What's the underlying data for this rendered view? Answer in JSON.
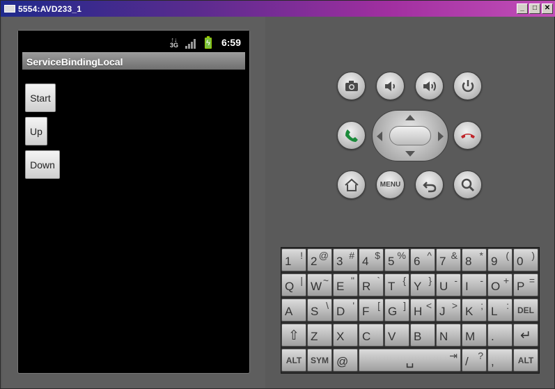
{
  "window": {
    "title": "5554:AVD233_1",
    "minimize": "_",
    "maximize": "□",
    "close": "✕"
  },
  "status_bar": {
    "time": "6:59",
    "network": "3G"
  },
  "app": {
    "title": "ServiceBindingLocal",
    "buttons": [
      "Start",
      "Up",
      "Down"
    ]
  },
  "controls": {
    "camera": "camera-icon",
    "volume_down": "volume-down-icon",
    "volume_up": "volume-up-icon",
    "power": "power-icon",
    "call": "call-icon",
    "end_call": "end-call-icon",
    "home": "home-icon",
    "menu": "MENU",
    "back": "back-icon",
    "search": "search-icon"
  },
  "keyboard": {
    "rows": [
      [
        [
          "1",
          "!"
        ],
        [
          "2",
          "@"
        ],
        [
          "3",
          "#"
        ],
        [
          "4",
          "$"
        ],
        [
          "5",
          "%"
        ],
        [
          "6",
          "^"
        ],
        [
          "7",
          "&"
        ],
        [
          "8",
          "*"
        ],
        [
          "9",
          "("
        ],
        [
          "0",
          ")"
        ]
      ],
      [
        [
          "Q",
          "|"
        ],
        [
          "W",
          "~"
        ],
        [
          "E",
          "\""
        ],
        [
          "R",
          "`"
        ],
        [
          "T",
          "{"
        ],
        [
          "Y",
          "}"
        ],
        [
          "U",
          "-"
        ],
        [
          "I",
          "-"
        ],
        [
          "O",
          "+"
        ],
        [
          "P",
          "="
        ]
      ],
      [
        [
          "A",
          ""
        ],
        [
          "S",
          "\\"
        ],
        [
          "D",
          "'"
        ],
        [
          "F",
          "["
        ],
        [
          "G",
          "]"
        ],
        [
          "H",
          "<"
        ],
        [
          "J",
          ">"
        ],
        [
          "K",
          ";"
        ],
        [
          "L",
          ":"
        ],
        [
          "DEL",
          ""
        ]
      ],
      [
        [
          "⇧",
          ""
        ],
        [
          "Z",
          ""
        ],
        [
          "X",
          ""
        ],
        [
          "C",
          ""
        ],
        [
          "V",
          ""
        ],
        [
          "B",
          ""
        ],
        [
          "N",
          ""
        ],
        [
          "M",
          ""
        ],
        [
          ".",
          ""
        ],
        [
          "↵",
          ""
        ]
      ],
      [
        [
          "ALT",
          ""
        ],
        [
          "SYM",
          ""
        ],
        [
          "@",
          ""
        ],
        [
          "␣",
          "⇥"
        ],
        [
          "/",
          "?"
        ],
        [
          ",",
          ""
        ],
        [
          "ALT",
          ""
        ]
      ]
    ]
  },
  "colors": {
    "end_call": "#c0262b",
    "call": "#1b8a3a",
    "battery": "#7bc142"
  }
}
